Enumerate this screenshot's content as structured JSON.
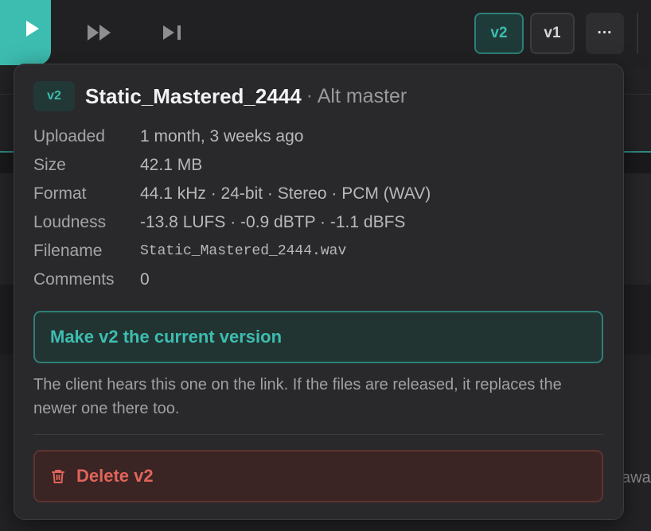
{
  "player": {
    "play_icon": "play-icon",
    "fast_forward_icon": "fast-forward-icon",
    "skip_next_icon": "skip-next-icon",
    "version_buttons": [
      "v2",
      "v1"
    ],
    "more_label": "···"
  },
  "background": {
    "partial_text": "awa"
  },
  "popover": {
    "version_badge": "v2",
    "file_title": "Static_Mastered_2444",
    "separator": "·",
    "alt_label": "Alt master",
    "details": [
      {
        "key": "Uploaded",
        "value": "1 month, 3 weeks ago"
      },
      {
        "key": "Size",
        "value": "42.1 MB"
      },
      {
        "key": "Format",
        "value": "44.1 kHz · 24-bit · Stereo · PCM (WAV)"
      },
      {
        "key": "Loudness",
        "value": "-13.8 LUFS · -0.9 dBTP · -1.1 dBFS"
      },
      {
        "key": "Filename",
        "value": "Static_Mastered_2444.wav"
      },
      {
        "key": "Comments",
        "value": "0"
      }
    ],
    "make_current_label": "Make v2 the current version",
    "help_text": "The client hears this one on the link. If the files are released, it replaces the newer one there too.",
    "delete_label": "Delete v2",
    "delete_icon": "trash-icon"
  },
  "colors": {
    "accent": "#3dbdb0",
    "danger": "#e0645a",
    "background": "#232326",
    "popover": "#29292c"
  }
}
